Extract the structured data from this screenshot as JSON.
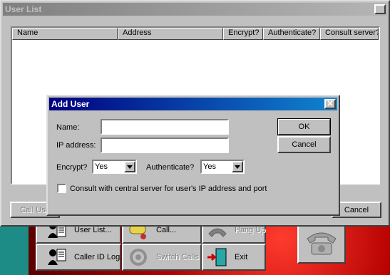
{
  "toolbar": {
    "user_list": "User List...",
    "call": "Call...",
    "hang_up": "Hang Up",
    "caller_id_log": "Caller ID Log...",
    "switch_calls": "Switch Calls",
    "exit": "Exit"
  },
  "user_list": {
    "title": "User List",
    "columns": [
      "Name",
      "Address",
      "Encrypt?",
      "Authenticate?",
      "Consult server?"
    ],
    "rows": [],
    "call_user_button": "Call Use",
    "cancel_button": "Cancel"
  },
  "add_user": {
    "title": "Add User",
    "name_label": "Name:",
    "name_value": "",
    "ip_label": "IP address:",
    "ip_value": "",
    "encrypt_label": "Encrypt?",
    "encrypt_value": "Yes",
    "authenticate_label": "Authenticate?",
    "authenticate_value": "Yes",
    "consult_label": "Consult with central server for user's IP address and port",
    "consult_checked": false,
    "ok_button": "OK",
    "cancel_button": "Cancel"
  },
  "close_glyph": "✕",
  "icons": {
    "user_list": "user-list-icon",
    "call": "call-icon",
    "hang_up": "hang-up-icon",
    "caller_id": "caller-id-icon",
    "switch_calls": "switch-calls-icon",
    "exit": "exit-door-icon",
    "big_phone": "telephone-icon"
  }
}
